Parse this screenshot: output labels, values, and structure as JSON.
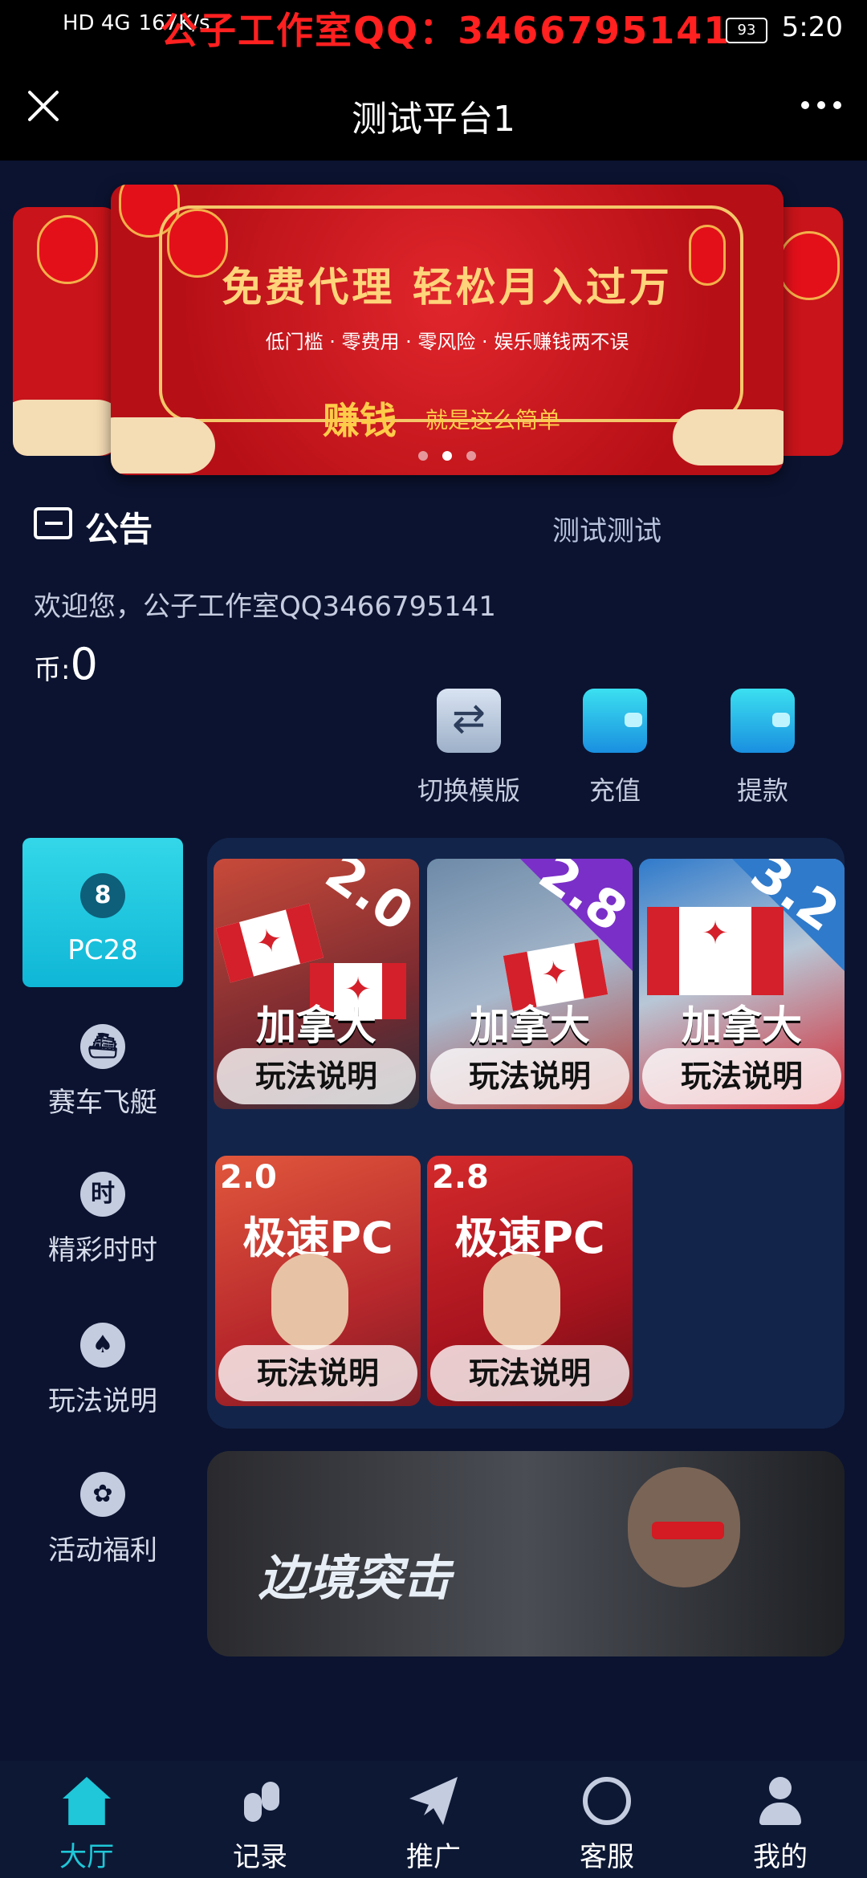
{
  "status_bar": {
    "network": "HD 4G",
    "speed": "167K/s",
    "watermark": "公子工作室QQ：3466795141",
    "battery": "93",
    "time": "5:20"
  },
  "titlebar": {
    "title": "测试平台1"
  },
  "banner": {
    "headline": "免费代理 轻松月入过万",
    "subline": "低门槛 · 零费用 · 零风险 · 娱乐赚钱两不误",
    "money_big": "赚钱",
    "money_small": "就是这么简单",
    "dots": 3,
    "active_dot": 1
  },
  "notice": {
    "label": "公告",
    "text": "测试测试"
  },
  "welcome": "欢迎您，公子工作室QQ3466795141",
  "coin": {
    "label": "币:",
    "value": "0"
  },
  "actions": [
    {
      "label": "切换模版",
      "icon": "switch-icon"
    },
    {
      "label": "充值",
      "icon": "wallet-icon"
    },
    {
      "label": "提款",
      "icon": "wallet-icon"
    }
  ],
  "sidebar": [
    {
      "label": "PC28",
      "icon": "billiard-8-icon",
      "active": true
    },
    {
      "label": "赛车飞艇",
      "icon": "speedboat-icon"
    },
    {
      "label": "精彩时时",
      "icon": "shishi-icon"
    },
    {
      "label": "玩法说明",
      "icon": "cards-icon"
    },
    {
      "label": "活动福利",
      "icon": "gift-icon"
    }
  ],
  "games": [
    {
      "version": "2.0",
      "title": "加拿大",
      "button": "玩法说明"
    },
    {
      "version": "2.8",
      "title": "加拿大",
      "button": "玩法说明"
    },
    {
      "version": "3.2",
      "title": "加拿大",
      "button": "玩法说明"
    },
    {
      "version": "2.0",
      "title": "极速PC",
      "button": "玩法说明"
    },
    {
      "version": "2.8",
      "title": "极速PC",
      "button": "玩法说明"
    }
  ],
  "promo": {
    "title": "边境突击"
  },
  "tabbar": [
    {
      "label": "大厅",
      "icon": "home-icon",
      "active": true
    },
    {
      "label": "记录",
      "icon": "footprint-icon"
    },
    {
      "label": "推广",
      "icon": "paper-plane-icon"
    },
    {
      "label": "客服",
      "icon": "headset-icon"
    },
    {
      "label": "我的",
      "icon": "user-icon"
    }
  ],
  "colors": {
    "accent": "#1fc7d8",
    "background": "#0b1330",
    "banner_red": "#c8141a"
  }
}
